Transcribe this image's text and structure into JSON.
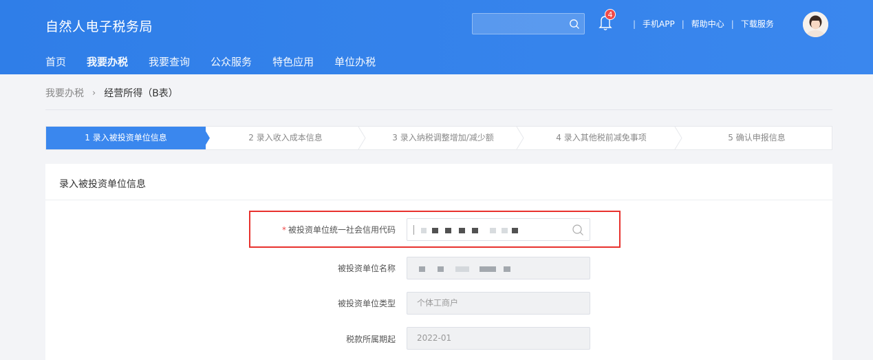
{
  "header": {
    "title": "自然人电子税务局",
    "search_placeholder": "",
    "notification_count": "4",
    "links": [
      "手机APP",
      "帮助中心",
      "下载服务"
    ]
  },
  "nav": {
    "items": [
      "首页",
      "我要办税",
      "我要查询",
      "公众服务",
      "特色应用",
      "单位办税"
    ],
    "active_index": 1
  },
  "breadcrumb": {
    "parent": "我要办税",
    "separator": "›",
    "current": "经营所得（B表）"
  },
  "steps": [
    {
      "label": "1  录入被投资单位信息",
      "active": true
    },
    {
      "label": "2  录入收入成本信息",
      "active": false
    },
    {
      "label": "3  录入纳税调整增加/减少额",
      "active": false
    },
    {
      "label": "4  录入其他税前减免事项",
      "active": false
    },
    {
      "label": "5  确认申报信息",
      "active": false
    }
  ],
  "form": {
    "title": "录入被投资单位信息",
    "required_mark": "*",
    "fields": [
      {
        "label": "被投资单位统一社会信用代码",
        "value": ""
      },
      {
        "label": "被投资单位名称",
        "value": ""
      },
      {
        "label": "被投资单位类型",
        "value": "个体工商户"
      },
      {
        "label": "税款所属期起",
        "value": "2022-01"
      }
    ]
  },
  "colors": {
    "header_blue": "#3a87ee",
    "highlight_red": "#e8312d",
    "badge_red": "#ef4a4a"
  }
}
